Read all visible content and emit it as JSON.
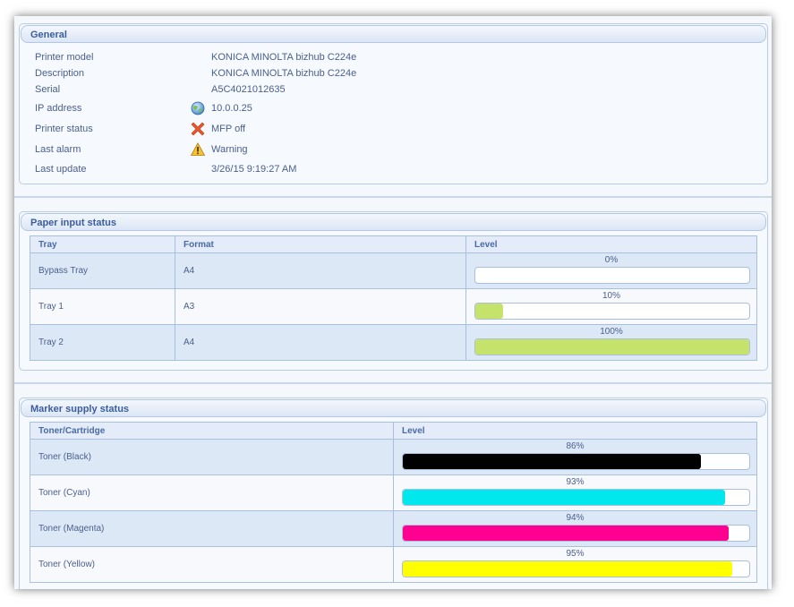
{
  "general": {
    "title": "General",
    "rows": [
      {
        "label": "Printer model",
        "value": "KONICA MINOLTA bizhub C224e",
        "icon": ""
      },
      {
        "label": "Description",
        "value": "KONICA MINOLTA bizhub C224e",
        "icon": ""
      },
      {
        "label": "Serial",
        "value": "A5C4021012635",
        "icon": ""
      },
      {
        "label": "IP address",
        "value": "10.0.0.25",
        "icon": "globe-icon"
      },
      {
        "label": "Printer status",
        "value": "MFP off",
        "icon": "error-x-icon"
      },
      {
        "label": "Last alarm",
        "value": "Warning",
        "icon": "warning-icon"
      },
      {
        "label": "Last update",
        "value": "3/26/15 9:19:27 AM",
        "icon": ""
      }
    ]
  },
  "paper_input": {
    "title": "Paper input status",
    "headers": {
      "tray": "Tray",
      "format": "Format",
      "level": "Level"
    },
    "rows": [
      {
        "tray": "Bypass Tray",
        "format": "A4",
        "level_label": "0%",
        "level": 0,
        "color": "#c5e36a"
      },
      {
        "tray": "Tray 1",
        "format": "A3",
        "level_label": "10%",
        "level": 10,
        "color": "#c5e36a"
      },
      {
        "tray": "Tray 2",
        "format": "A4",
        "level_label": "100%",
        "level": 100,
        "color": "#c5e36a"
      }
    ]
  },
  "marker_supply": {
    "title": "Marker supply status",
    "headers": {
      "toner": "Toner/Cartridge",
      "level": "Level"
    },
    "rows": [
      {
        "name": "Toner (Black)",
        "level_label": "86%",
        "level": 86,
        "color": "#000000"
      },
      {
        "name": "Toner (Cyan)",
        "level_label": "93%",
        "level": 93,
        "color": "#00e8ee"
      },
      {
        "name": "Toner (Magenta)",
        "level_label": "94%",
        "level": 94,
        "color": "#ff0090"
      },
      {
        "name": "Toner (Yellow)",
        "level_label": "95%",
        "level": 95,
        "color": "#ffff00"
      }
    ]
  }
}
